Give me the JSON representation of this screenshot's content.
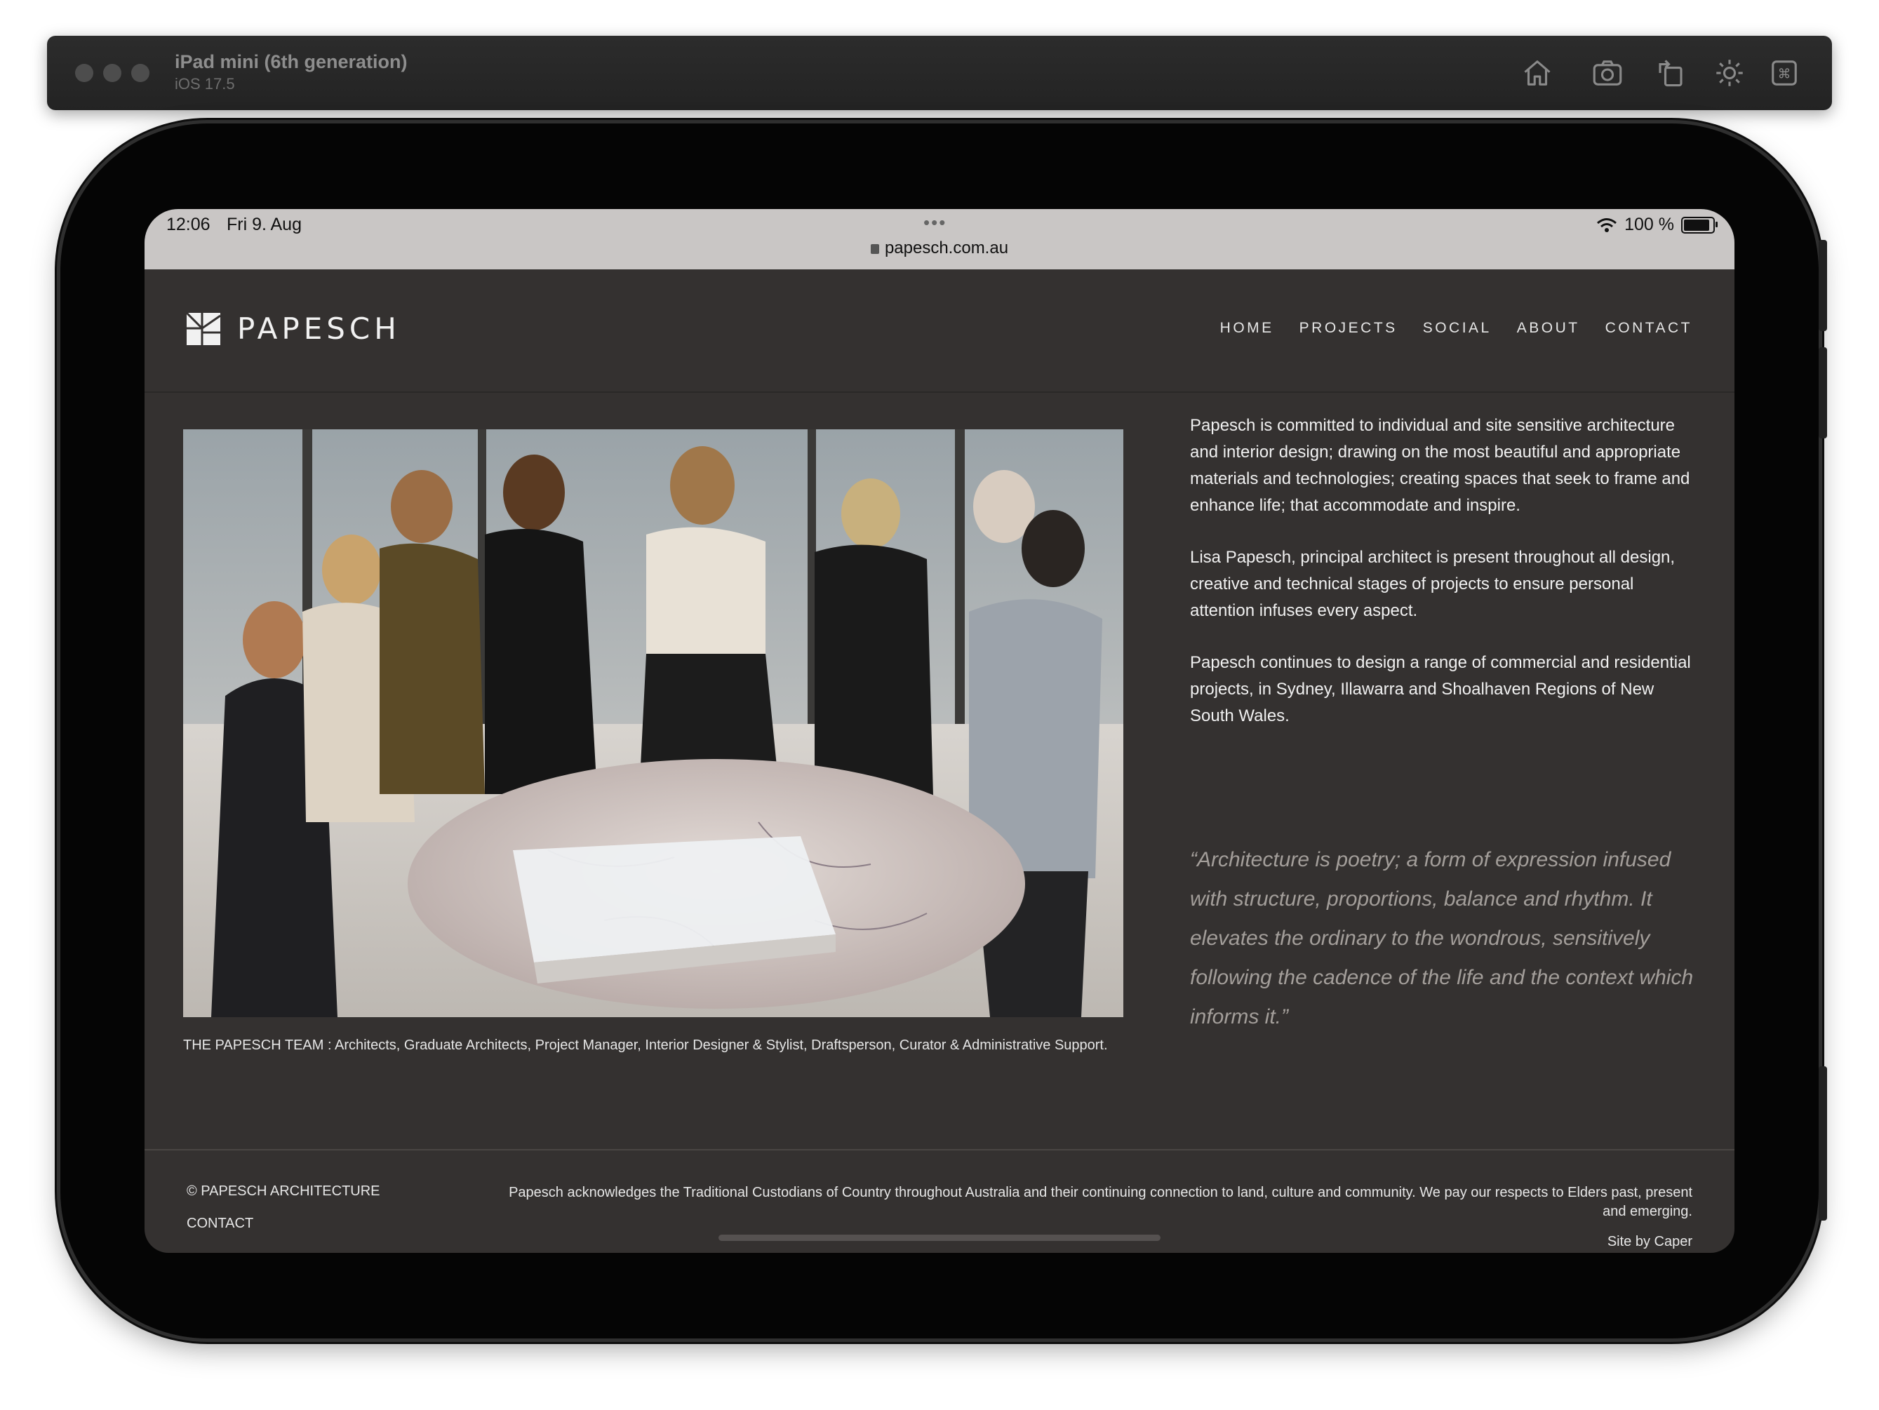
{
  "simulator": {
    "device_name": "iPad mini (6th generation)",
    "os_version": "iOS 17.5",
    "toolbar_icons": [
      "home-icon",
      "screenshot-icon",
      "rotate-icon",
      "appearance-icon",
      "keyboard-command-icon"
    ]
  },
  "status_bar": {
    "time": "12:06",
    "date": "Fri 9. Aug",
    "url": "papesch.com.au",
    "battery": "100 %",
    "battery_level": 1.0
  },
  "header": {
    "logo_text": "PAPESCH",
    "nav": [
      "HOME",
      "PROJECTS",
      "SOCIAL",
      "ABOUT",
      "CONTACT"
    ]
  },
  "main": {
    "caption": "THE PAPESCH TEAM : Architects, Graduate Architects, Project Manager, Interior Designer & Stylist, Draftsperson, Curator & Administrative Support.",
    "paragraphs": [
      "Papesch is committed to individual and site sensitive architecture and interior design; drawing on the most beautiful and appropriate materials and technologies; creating spaces that seek to frame and enhance life; that accommodate and inspire.",
      "Lisa Papesch, principal architect is present throughout all design, creative and technical stages of projects to ensure personal attention infuses every aspect.",
      "Papesch continues to design a range of commercial and residential projects, in Sydney, Illawarra and Shoalhaven Regions of New South Wales."
    ],
    "quote": "“Architecture is poetry; a form of expression infused with structure, proportions, balance and rhythm. It elevates the ordinary to the wondrous, sensitively following the cadence of the life and the context which informs it.”"
  },
  "footer": {
    "copyright": "© PAPESCH ARCHITECTURE",
    "contact": "CONTACT",
    "acknowledgement": "Papesch acknowledges the Traditional Custodians of Country throughout Australia and their continuing connection to land, culture and community. We pay our respects to Elders past, present and emerging.",
    "credit": "Site by Caper"
  },
  "colors": {
    "page_background": "#343130",
    "quote_text": "#a39e9a",
    "status_bar": "#c9c6c5"
  }
}
